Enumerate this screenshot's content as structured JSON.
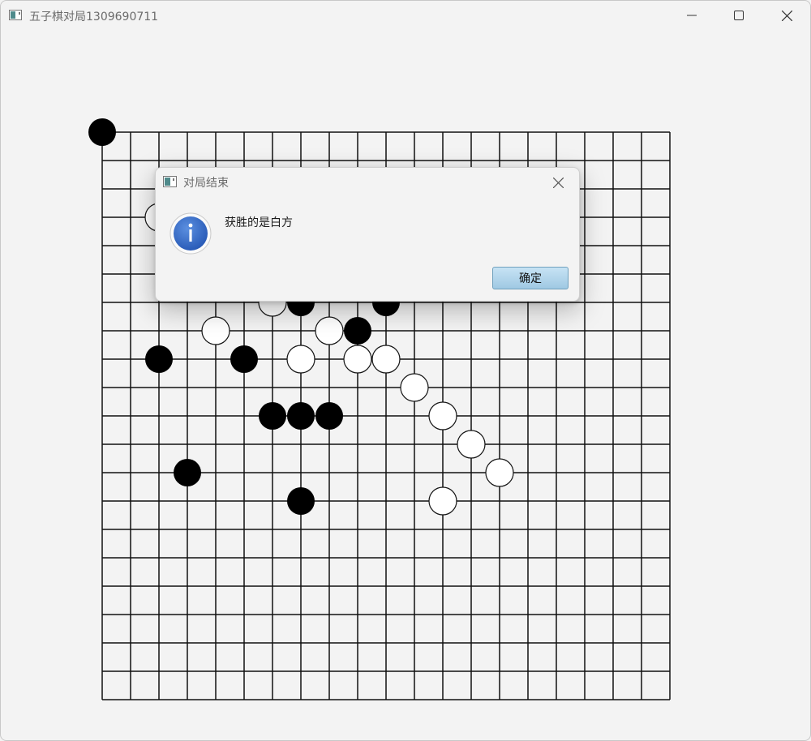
{
  "window": {
    "title": "五子棋对局1309690711"
  },
  "board": {
    "rows": 21,
    "cols": 21,
    "stones": [
      {
        "color": "black",
        "col": 0,
        "row": 0
      },
      {
        "color": "white",
        "col": 2,
        "row": 3
      },
      {
        "color": "white",
        "col": 6,
        "row": 6
      },
      {
        "color": "black",
        "col": 7,
        "row": 6
      },
      {
        "color": "black",
        "col": 10,
        "row": 6
      },
      {
        "color": "white",
        "col": 4,
        "row": 7
      },
      {
        "color": "white",
        "col": 8,
        "row": 7
      },
      {
        "color": "black",
        "col": 9,
        "row": 7
      },
      {
        "color": "black",
        "col": 2,
        "row": 8
      },
      {
        "color": "black",
        "col": 5,
        "row": 8
      },
      {
        "color": "white",
        "col": 7,
        "row": 8
      },
      {
        "color": "white",
        "col": 9,
        "row": 8
      },
      {
        "color": "white",
        "col": 10,
        "row": 8
      },
      {
        "color": "white",
        "col": 11,
        "row": 9
      },
      {
        "color": "black",
        "col": 6,
        "row": 10
      },
      {
        "color": "black",
        "col": 7,
        "row": 10
      },
      {
        "color": "black",
        "col": 8,
        "row": 10
      },
      {
        "color": "white",
        "col": 12,
        "row": 10
      },
      {
        "color": "white",
        "col": 13,
        "row": 11
      },
      {
        "color": "black",
        "col": 3,
        "row": 12
      },
      {
        "color": "white",
        "col": 14,
        "row": 12
      },
      {
        "color": "black",
        "col": 7,
        "row": 13
      },
      {
        "color": "white",
        "col": 12,
        "row": 13
      }
    ]
  },
  "dialog": {
    "title": "对局结束",
    "message": "获胜的是白方",
    "ok_label": "确定"
  }
}
